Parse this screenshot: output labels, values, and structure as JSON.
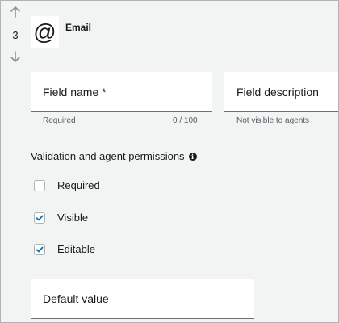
{
  "field": {
    "index": "3",
    "type_label": "Email",
    "type_icon": "at-sign-icon",
    "move_up_icon": "arrow-up-icon",
    "move_down_icon": "arrow-down-icon"
  },
  "inputs": {
    "field_name": {
      "placeholder": "Field name *",
      "hint": "Required",
      "count": "0 / 100"
    },
    "field_description": {
      "placeholder": "Field description",
      "hint": "Not visible to agents"
    },
    "default_value": {
      "placeholder": "Default value"
    }
  },
  "permissions": {
    "title": "Validation and agent permissions",
    "info_icon": "info-icon",
    "options": [
      {
        "label": "Required",
        "checked": false
      },
      {
        "label": "Visible",
        "checked": true
      },
      {
        "label": "Editable",
        "checked": true
      }
    ]
  },
  "colors": {
    "background": "#f2f3f3",
    "surface": "#ffffff",
    "checkbox_check": "#0073bb",
    "text": "#16191f",
    "muted_text": "#545b64"
  }
}
